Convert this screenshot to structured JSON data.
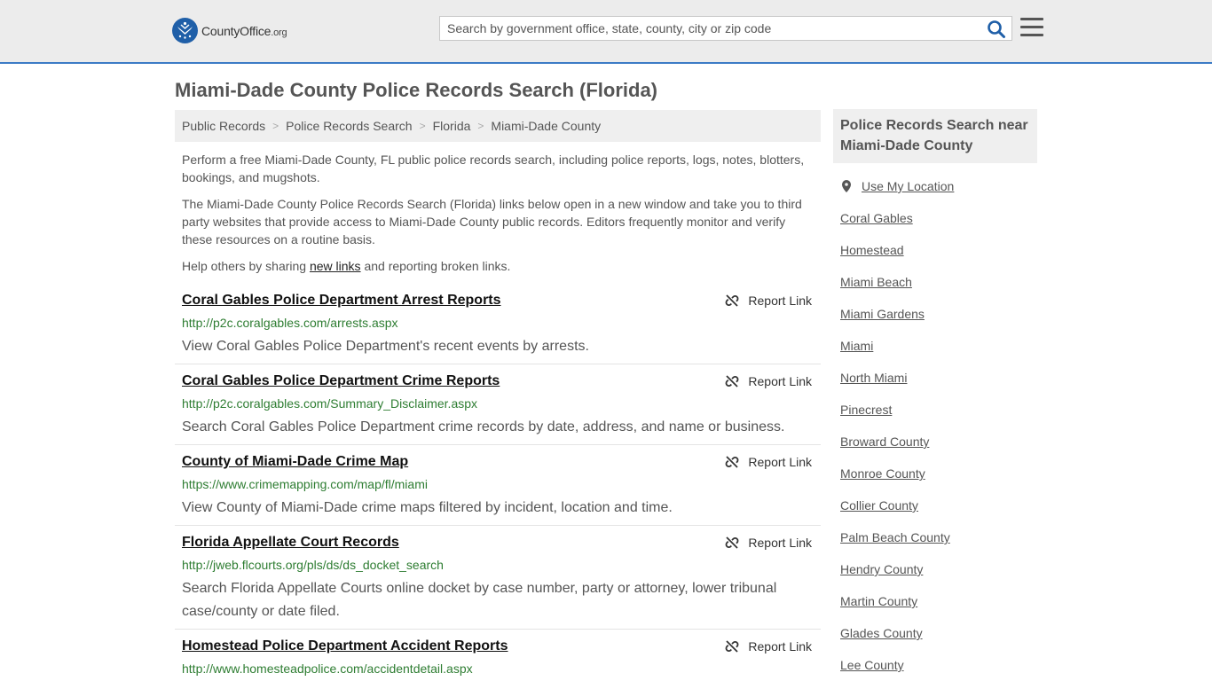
{
  "header": {
    "logo_main": "CountyOffice",
    "logo_tld": ".org",
    "search_placeholder": "Search by government office, state, county, city or zip code"
  },
  "page_title": "Miami-Dade County Police Records Search (Florida)",
  "breadcrumb": [
    "Public Records",
    "Police Records Search",
    "Florida",
    "Miami-Dade County"
  ],
  "intro": {
    "p1": "Perform a free Miami-Dade County, FL public police records search, including police reports, logs, notes, blotters, bookings, and mugshots.",
    "p2": "The Miami-Dade County Police Records Search (Florida) links below open in a new window and take you to third party websites that provide access to Miami-Dade County public records. Editors frequently monitor and verify these resources on a routine basis.",
    "p3_before": "Help others by sharing ",
    "p3_link": "new links",
    "p3_after": " and reporting broken links."
  },
  "report_label": "Report Link",
  "results": [
    {
      "title": "Coral Gables Police Department Arrest Reports",
      "url": "http://p2c.coralgables.com/arrests.aspx",
      "desc": "View Coral Gables Police Department's recent events by arrests."
    },
    {
      "title": "Coral Gables Police Department Crime Reports",
      "url": "http://p2c.coralgables.com/Summary_Disclaimer.aspx",
      "desc": "Search Coral Gables Police Department crime records by date, address, and name or business."
    },
    {
      "title": "County of Miami-Dade Crime Map",
      "url": "https://www.crimemapping.com/map/fl/miami",
      "desc": "View County of Miami-Dade crime maps filtered by incident, location and time."
    },
    {
      "title": "Florida Appellate Court Records",
      "url": "http://jweb.flcourts.org/pls/ds/ds_docket_search",
      "desc": "Search Florida Appellate Courts online docket by case number, party or attorney, lower tribunal case/county or date filed."
    },
    {
      "title": "Homestead Police Department Accident Reports",
      "url": "http://www.homesteadpolice.com/accidentdetail.aspx",
      "desc": ""
    }
  ],
  "sidebar": {
    "title": "Police Records Search near Miami-Dade County",
    "use_location": "Use My Location",
    "links": [
      "Coral Gables",
      "Homestead",
      "Miami Beach",
      "Miami Gardens",
      "Miami",
      "North Miami",
      "Pinecrest",
      "Broward County",
      "Monroe County",
      "Collier County",
      "Palm Beach County",
      "Hendry County",
      "Martin County",
      "Glades County",
      "Lee County"
    ]
  },
  "colors": {
    "accent": "#3c7bc5",
    "logo_blue": "#1f5fa8",
    "url_green": "#2e7d32"
  }
}
